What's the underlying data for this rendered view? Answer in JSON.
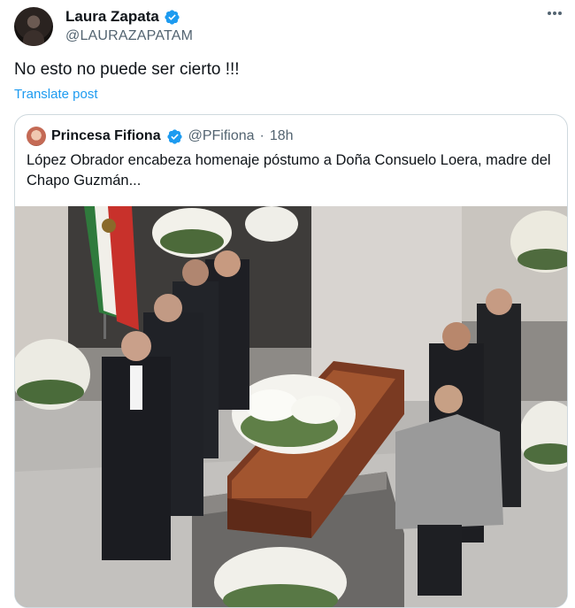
{
  "author": {
    "name": "Laura Zapata",
    "handle": "@LAURAZAPATAM",
    "verified": true
  },
  "post": {
    "text": "No esto no puede ser cierto !!!",
    "translate_label": "Translate post"
  },
  "more_icon": "more-horizontal-icon",
  "quoted_post": {
    "author_name": "Princesa Fifiona",
    "handle": "@PFifiona",
    "separator": "·",
    "time": "18h",
    "verified": true,
    "text": "López Obrador encabeza homenaje póstumo a Doña Consuelo Loera, madre del Chapo Guzmán..."
  },
  "colors": {
    "link": "#1d9bf0",
    "verified": "#1d9bf0",
    "secondary_text": "#536471",
    "border": "#cfd9de"
  }
}
